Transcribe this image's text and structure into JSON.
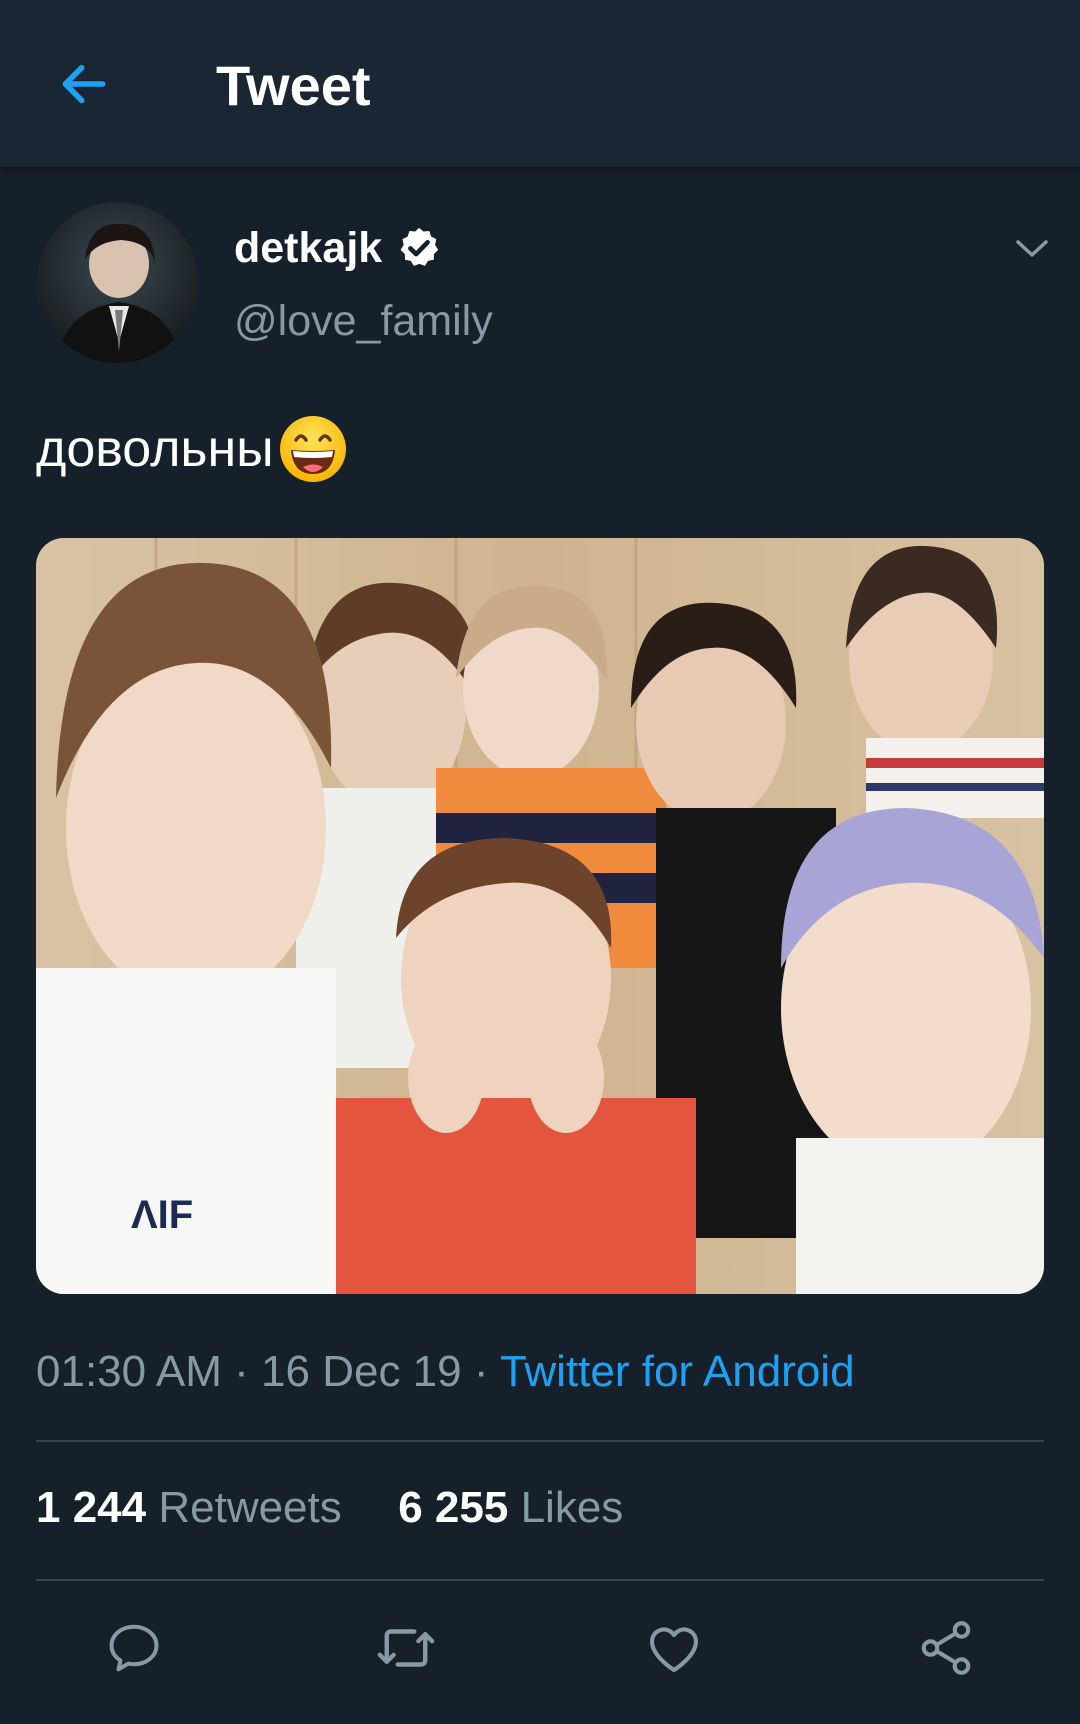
{
  "header": {
    "title": "Tweet",
    "back_icon": "arrow-left-icon"
  },
  "tweet": {
    "display_name": "detkajk",
    "handle": "@love_family",
    "verified": true,
    "text": "довольны",
    "emoji": "grinning-face-emoji",
    "time": "01:30 AM",
    "date": "16 Dec 19",
    "separator": "·",
    "client": "Twitter for Android"
  },
  "stats": {
    "retweets_count": "1 244",
    "retweets_label": "Retweets",
    "likes_count": "6 255",
    "likes_label": "Likes"
  },
  "actions": [
    "reply-icon",
    "retweet-icon",
    "like-icon",
    "share-icon"
  ],
  "colors": {
    "background": "#15202b",
    "header_background": "#1b2634",
    "accent": "#1da1f2",
    "secondary_text": "#8899a6",
    "divider": "#38444d"
  }
}
